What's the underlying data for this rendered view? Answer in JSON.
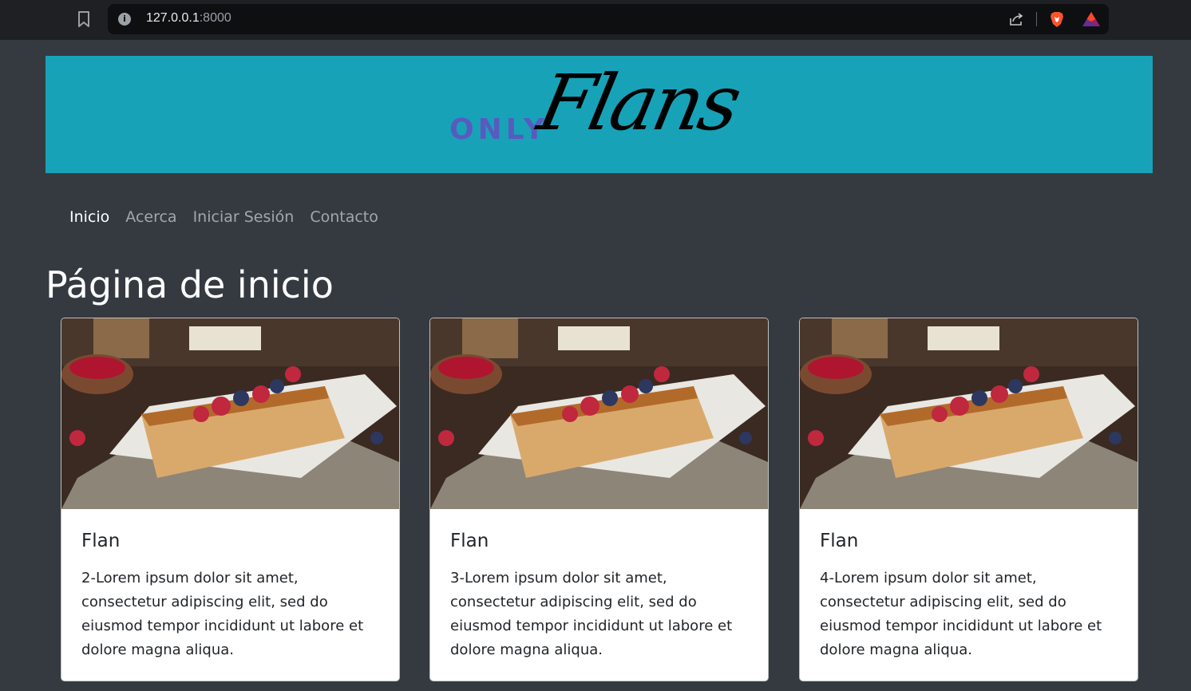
{
  "browser": {
    "url_host": "127.0.0.1",
    "url_port": ":8000"
  },
  "banner": {
    "logo_small": "ONLY",
    "logo_script": "Flans",
    "background_color": "#17a2b8"
  },
  "nav": {
    "items": [
      {
        "label": "Inicio",
        "active": true
      },
      {
        "label": "Acerca",
        "active": false
      },
      {
        "label": "Iniciar Sesión",
        "active": false
      },
      {
        "label": "Contacto",
        "active": false
      }
    ]
  },
  "page": {
    "title": "Página de inicio"
  },
  "cards": [
    {
      "title": "Flan",
      "text": "2-Lorem ipsum dolor sit amet, consectetur adipiscing elit, sed do eiusmod tempor incididunt ut labore et dolore magna aliqua.",
      "image": "flan-photo"
    },
    {
      "title": "Flan",
      "text": "3-Lorem ipsum dolor sit amet, consectetur adipiscing elit, sed do eiusmod tempor incididunt ut labore et dolore magna aliqua.",
      "image": "flan-photo"
    },
    {
      "title": "Flan",
      "text": "4-Lorem ipsum dolor sit amet, consectetur adipiscing elit, sed do eiusmod tempor incididunt ut labore et dolore magna aliqua.",
      "image": "flan-photo"
    }
  ],
  "colors": {
    "page_background": "#343a40",
    "card_background": "#ffffff",
    "logo_accent": "#6f42c1"
  }
}
